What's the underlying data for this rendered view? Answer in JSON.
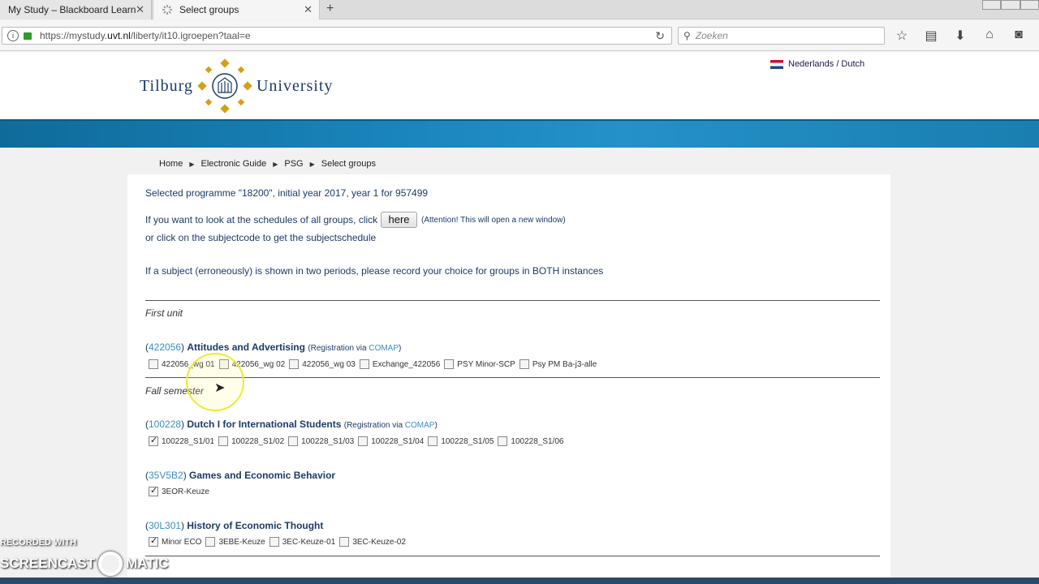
{
  "browser": {
    "tabs": [
      {
        "label": "My Study – Blackboard Learn"
      },
      {
        "label": "Select groups"
      }
    ],
    "url_prefix": "https://mystudy.",
    "url_domain": "uvt.nl",
    "url_path": "/liberty/it10.igroepen?taal=e",
    "search_placeholder": "Zoeken"
  },
  "header": {
    "logo_left": "Tilburg",
    "logo_right": "University",
    "language_link": "Nederlands / Dutch"
  },
  "breadcrumb": [
    "Home",
    "Electronic Guide",
    "PSG",
    "Select groups"
  ],
  "intro": {
    "selected": "Selected programme \"18200\", initial year 2017, year 1 for 957499",
    "schedules_text": "If you want to look at the schedules of all groups, click",
    "here_button": "here",
    "attention": "(Attention! This will open a new window)",
    "subjectcode_text": "or click on the subjectcode to get the subjectschedule",
    "warning": "If a subject (erroneously) is shown in two periods, please record your choice for groups in BOTH instances"
  },
  "sections": [
    {
      "title": "First unit",
      "subjects": [
        {
          "code": "422056",
          "name": "Attitudes and Advertising",
          "registration": "(Registration via ",
          "comap": "COMAP",
          "groups": [
            {
              "label": "422056_wg 01",
              "checked": false
            },
            {
              "label": "422056_wg 02",
              "checked": false
            },
            {
              "label": "422056_wg 03",
              "checked": false
            },
            {
              "label": "Exchange_422056",
              "checked": false
            },
            {
              "label": "PSY Minor-SCP",
              "checked": false
            },
            {
              "label": "Psy PM Ba-j3-alle",
              "checked": false
            }
          ]
        }
      ]
    },
    {
      "title": "Fall semester",
      "subjects": [
        {
          "code": "100228",
          "name": "Dutch I for International Students",
          "registration": "(Registration via ",
          "comap": "COMAP",
          "groups": [
            {
              "label": "100228_S1/01",
              "checked": true
            },
            {
              "label": "100228_S1/02",
              "checked": false
            },
            {
              "label": "100228_S1/03",
              "checked": false
            },
            {
              "label": "100228_S1/04",
              "checked": false
            },
            {
              "label": "100228_S1/05",
              "checked": false
            },
            {
              "label": "100228_S1/06",
              "checked": false
            }
          ]
        },
        {
          "code": "35V5B2",
          "name": "Games and Economic Behavior",
          "groups": [
            {
              "label": "3EOR-Keuze",
              "checked": true
            }
          ]
        },
        {
          "code": "30L301",
          "name": "History of Economic Thought",
          "groups": [
            {
              "label": "Minor ECO",
              "checked": true
            },
            {
              "label": "3EBE-Keuze",
              "checked": false
            },
            {
              "label": "3EC-Keuze-01",
              "checked": false
            },
            {
              "label": "3EC-Keuze-02",
              "checked": false
            }
          ]
        }
      ]
    }
  ],
  "watermark": {
    "line1": "RECORDED WITH",
    "line2a": "SCREENCAST",
    "line2b": "MATIC"
  }
}
